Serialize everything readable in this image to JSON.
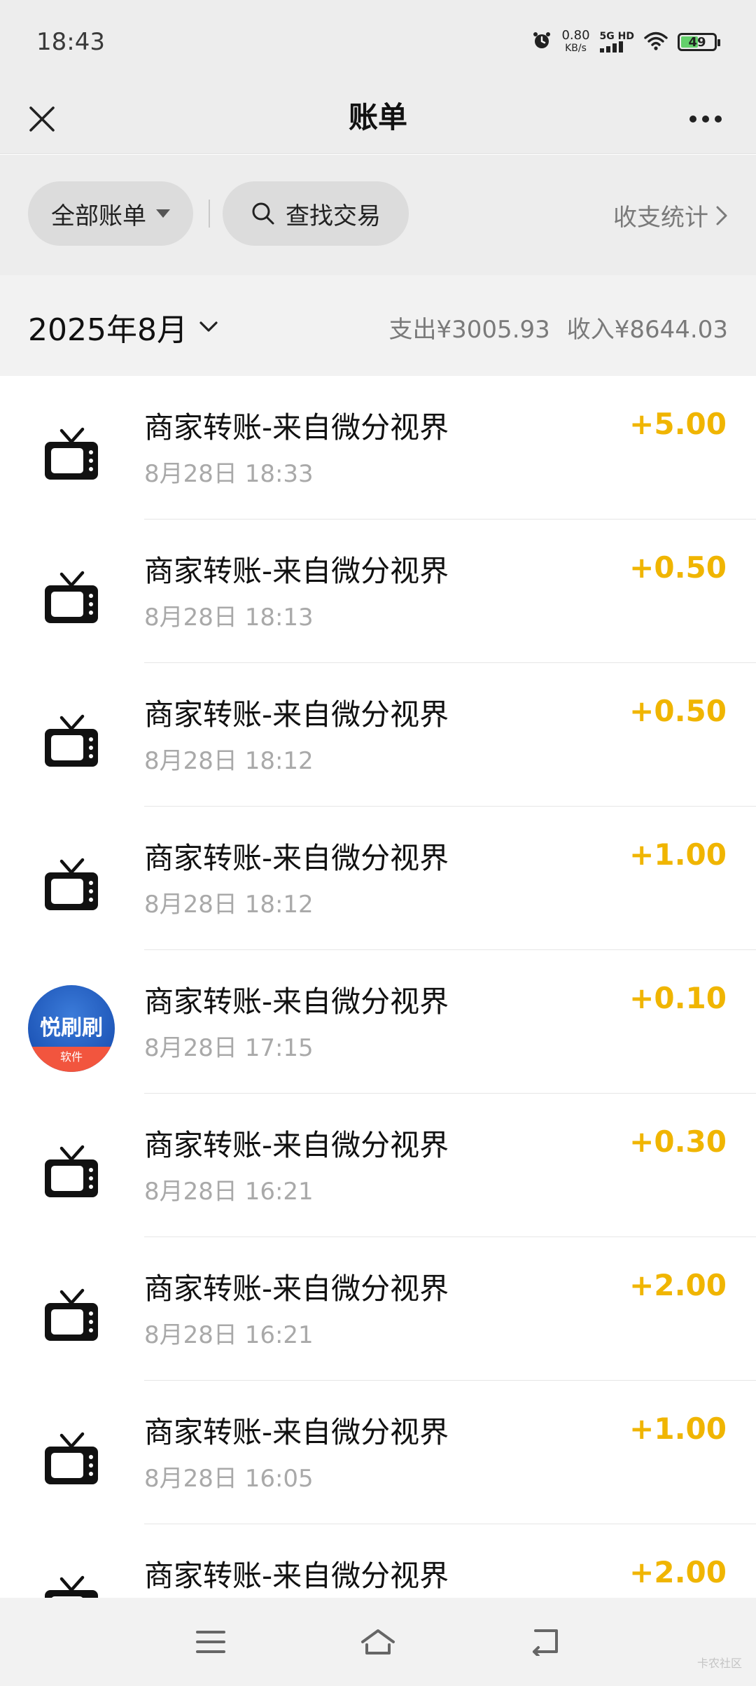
{
  "status_bar": {
    "time": "18:43",
    "net_speed_value": "0.80",
    "net_speed_unit": "KB/s",
    "network_type": "5G HD",
    "battery_level": "49"
  },
  "nav": {
    "title": "账单"
  },
  "filter": {
    "all_bills_label": "全部账单",
    "search_label": "查找交易",
    "stats_label": "收支统计"
  },
  "month": {
    "label": "2025年8月",
    "expense": "支出¥3005.93",
    "income": "收入¥8644.03"
  },
  "transactions": [
    {
      "title": "商家转账-来自微分视界",
      "time": "8月28日 18:33",
      "amount": "+5.00",
      "icon": "tv-icon"
    },
    {
      "title": "商家转账-来自微分视界",
      "time": "8月28日 18:13",
      "amount": "+0.50",
      "icon": "tv-icon"
    },
    {
      "title": "商家转账-来自微分视界",
      "time": "8月28日 18:12",
      "amount": "+0.50",
      "icon": "tv-icon"
    },
    {
      "title": "商家转账-来自微分视界",
      "time": "8月28日 18:12",
      "amount": "+1.00",
      "icon": "tv-icon"
    },
    {
      "title": "商家转账-来自微分视界",
      "time": "8月28日 17:15",
      "amount": "+0.10",
      "icon": "app-logo",
      "logo_main": "悦刷刷",
      "logo_sub": "软件"
    },
    {
      "title": "商家转账-来自微分视界",
      "time": "8月28日 16:21",
      "amount": "+0.30",
      "icon": "tv-icon"
    },
    {
      "title": "商家转账-来自微分视界",
      "time": "8月28日 16:21",
      "amount": "+2.00",
      "icon": "tv-icon"
    },
    {
      "title": "商家转账-来自微分视界",
      "time": "8月28日 16:05",
      "amount": "+1.00",
      "icon": "tv-icon"
    },
    {
      "title": "商家转账-来自微分视界",
      "time": "",
      "amount": "+2.00",
      "icon": "tv-icon"
    }
  ],
  "watermark": "卡农社区",
  "colors": {
    "income_amount": "#f0b500",
    "header_bg": "#ededed"
  }
}
